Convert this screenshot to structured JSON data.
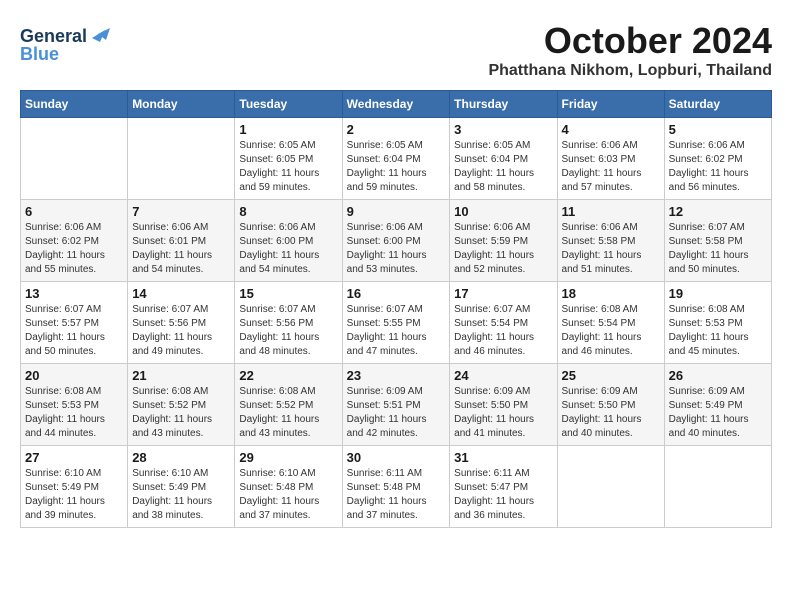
{
  "logo": {
    "line1": "General",
    "line2": "Blue"
  },
  "title": "October 2024",
  "location": "Phatthana Nikhom, Lopburi, Thailand",
  "weekdays": [
    "Sunday",
    "Monday",
    "Tuesday",
    "Wednesday",
    "Thursday",
    "Friday",
    "Saturday"
  ],
  "weeks": [
    [
      {
        "day": "",
        "info": ""
      },
      {
        "day": "",
        "info": ""
      },
      {
        "day": "1",
        "info": "Sunrise: 6:05 AM\nSunset: 6:05 PM\nDaylight: 11 hours and 59 minutes."
      },
      {
        "day": "2",
        "info": "Sunrise: 6:05 AM\nSunset: 6:04 PM\nDaylight: 11 hours and 59 minutes."
      },
      {
        "day": "3",
        "info": "Sunrise: 6:05 AM\nSunset: 6:04 PM\nDaylight: 11 hours and 58 minutes."
      },
      {
        "day": "4",
        "info": "Sunrise: 6:06 AM\nSunset: 6:03 PM\nDaylight: 11 hours and 57 minutes."
      },
      {
        "day": "5",
        "info": "Sunrise: 6:06 AM\nSunset: 6:02 PM\nDaylight: 11 hours and 56 minutes."
      }
    ],
    [
      {
        "day": "6",
        "info": "Sunrise: 6:06 AM\nSunset: 6:02 PM\nDaylight: 11 hours and 55 minutes."
      },
      {
        "day": "7",
        "info": "Sunrise: 6:06 AM\nSunset: 6:01 PM\nDaylight: 11 hours and 54 minutes."
      },
      {
        "day": "8",
        "info": "Sunrise: 6:06 AM\nSunset: 6:00 PM\nDaylight: 11 hours and 54 minutes."
      },
      {
        "day": "9",
        "info": "Sunrise: 6:06 AM\nSunset: 6:00 PM\nDaylight: 11 hours and 53 minutes."
      },
      {
        "day": "10",
        "info": "Sunrise: 6:06 AM\nSunset: 5:59 PM\nDaylight: 11 hours and 52 minutes."
      },
      {
        "day": "11",
        "info": "Sunrise: 6:06 AM\nSunset: 5:58 PM\nDaylight: 11 hours and 51 minutes."
      },
      {
        "day": "12",
        "info": "Sunrise: 6:07 AM\nSunset: 5:58 PM\nDaylight: 11 hours and 50 minutes."
      }
    ],
    [
      {
        "day": "13",
        "info": "Sunrise: 6:07 AM\nSunset: 5:57 PM\nDaylight: 11 hours and 50 minutes."
      },
      {
        "day": "14",
        "info": "Sunrise: 6:07 AM\nSunset: 5:56 PM\nDaylight: 11 hours and 49 minutes."
      },
      {
        "day": "15",
        "info": "Sunrise: 6:07 AM\nSunset: 5:56 PM\nDaylight: 11 hours and 48 minutes."
      },
      {
        "day": "16",
        "info": "Sunrise: 6:07 AM\nSunset: 5:55 PM\nDaylight: 11 hours and 47 minutes."
      },
      {
        "day": "17",
        "info": "Sunrise: 6:07 AM\nSunset: 5:54 PM\nDaylight: 11 hours and 46 minutes."
      },
      {
        "day": "18",
        "info": "Sunrise: 6:08 AM\nSunset: 5:54 PM\nDaylight: 11 hours and 46 minutes."
      },
      {
        "day": "19",
        "info": "Sunrise: 6:08 AM\nSunset: 5:53 PM\nDaylight: 11 hours and 45 minutes."
      }
    ],
    [
      {
        "day": "20",
        "info": "Sunrise: 6:08 AM\nSunset: 5:53 PM\nDaylight: 11 hours and 44 minutes."
      },
      {
        "day": "21",
        "info": "Sunrise: 6:08 AM\nSunset: 5:52 PM\nDaylight: 11 hours and 43 minutes."
      },
      {
        "day": "22",
        "info": "Sunrise: 6:08 AM\nSunset: 5:52 PM\nDaylight: 11 hours and 43 minutes."
      },
      {
        "day": "23",
        "info": "Sunrise: 6:09 AM\nSunset: 5:51 PM\nDaylight: 11 hours and 42 minutes."
      },
      {
        "day": "24",
        "info": "Sunrise: 6:09 AM\nSunset: 5:50 PM\nDaylight: 11 hours and 41 minutes."
      },
      {
        "day": "25",
        "info": "Sunrise: 6:09 AM\nSunset: 5:50 PM\nDaylight: 11 hours and 40 minutes."
      },
      {
        "day": "26",
        "info": "Sunrise: 6:09 AM\nSunset: 5:49 PM\nDaylight: 11 hours and 40 minutes."
      }
    ],
    [
      {
        "day": "27",
        "info": "Sunrise: 6:10 AM\nSunset: 5:49 PM\nDaylight: 11 hours and 39 minutes."
      },
      {
        "day": "28",
        "info": "Sunrise: 6:10 AM\nSunset: 5:49 PM\nDaylight: 11 hours and 38 minutes."
      },
      {
        "day": "29",
        "info": "Sunrise: 6:10 AM\nSunset: 5:48 PM\nDaylight: 11 hours and 37 minutes."
      },
      {
        "day": "30",
        "info": "Sunrise: 6:11 AM\nSunset: 5:48 PM\nDaylight: 11 hours and 37 minutes."
      },
      {
        "day": "31",
        "info": "Sunrise: 6:11 AM\nSunset: 5:47 PM\nDaylight: 11 hours and 36 minutes."
      },
      {
        "day": "",
        "info": ""
      },
      {
        "day": "",
        "info": ""
      }
    ]
  ]
}
